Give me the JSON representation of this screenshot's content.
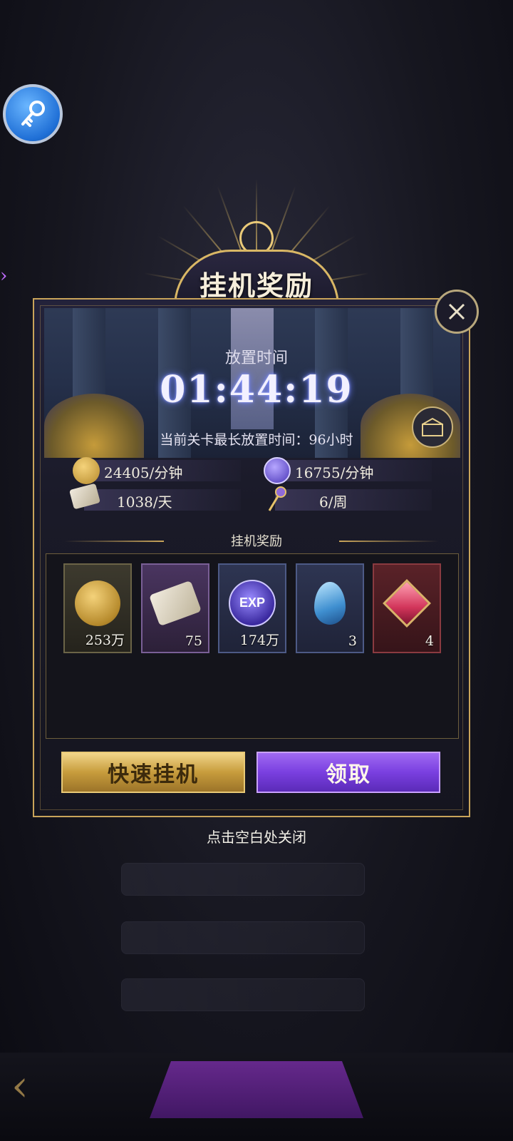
{
  "dialog": {
    "title": "挂机奖励",
    "idle_label": "放置时间",
    "timer": "01:44:19",
    "max_idle_text": "当前关卡最长放置时间：96小时",
    "rates": {
      "gold": "24405/分钟",
      "exp": "16755/分钟",
      "scroll": "1038/天",
      "key": "6/周"
    },
    "section_title": "挂机奖励",
    "rewards": [
      {
        "name": "gold-coin-icon",
        "count": "253万"
      },
      {
        "name": "scroll-icon",
        "count": "75"
      },
      {
        "name": "exp-orb-icon",
        "count": "174万"
      },
      {
        "name": "blue-crystal-icon",
        "count": "3"
      },
      {
        "name": "red-gem-icon",
        "count": "4"
      }
    ],
    "quick_idle_label": "快速挂机",
    "claim_label": "领取",
    "close_hint": "点击空白处关闭"
  },
  "colors": {
    "gold": "#c9a45a",
    "purple": "#7a3fe0",
    "key_blue": "#1f6fd6"
  }
}
